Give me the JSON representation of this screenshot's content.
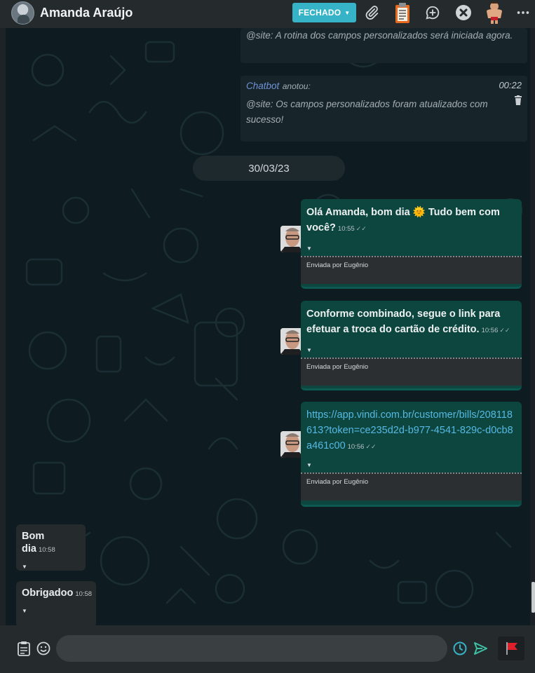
{
  "header": {
    "contact_name": "Amanda Araújo",
    "status_label": "FECHADO",
    "icons": [
      "paperclip-icon",
      "clipboard-icon",
      "chat-plus-icon",
      "close-circle-icon",
      "agent-avatar-icon",
      "more-icon"
    ]
  },
  "notes": [
    {
      "text": "@site: A rotina dos campos personalizados será iniciada agora."
    },
    {
      "author": "Chatbot",
      "verb": "anotou:",
      "time": "00:22",
      "text": "@site: Os campos personalizados foram atualizados com sucesso!"
    }
  ],
  "date_separator": "30/03/23",
  "outgoing": [
    {
      "text": "Olá Amanda, bom dia 🌞 Tudo bem com você?",
      "time": "10:55",
      "sent_by": "Enviada por Eugênio"
    },
    {
      "text": "Conforme combinado, segue o link para efetuar a troca do cartão de crédito.",
      "time": "10:56",
      "sent_by": "Enviada por Eugênio"
    },
    {
      "text": "https://app.vindi.com.br/customer/bills/208118613?token=ce235d2d-b977-4541-829c-d0cb8a461c00",
      "time": "10:56",
      "sent_by": "Enviada por Eugênio"
    }
  ],
  "incoming": [
    {
      "text": "Bom dia",
      "time": "10:58"
    },
    {
      "text": "Obrigadoo",
      "time": "10:58"
    }
  ],
  "composer": {
    "placeholder": ""
  },
  "colors": {
    "accent": "#36b3c6",
    "outgoing_bubble": "#0d463f",
    "incoming_bubble": "#252a2d",
    "send": "#3fc1a5",
    "flag": "#e0202a"
  }
}
